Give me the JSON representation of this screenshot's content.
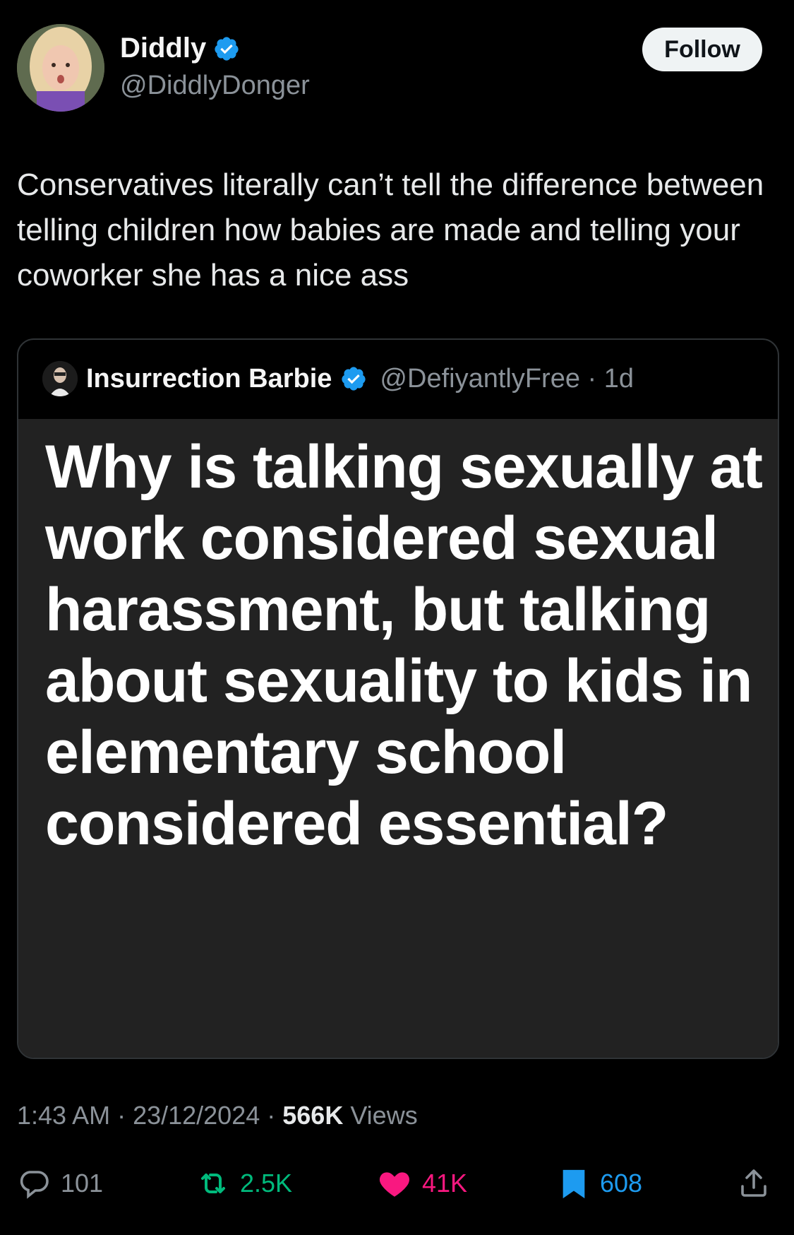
{
  "author": {
    "display_name": "Diddly",
    "handle": "@DiddlyDonger",
    "follow_label": "Follow"
  },
  "tweet": {
    "text": "Conservatives literally can’t tell the difference between telling children how babies are made and telling your coworker she has a nice ass"
  },
  "quote": {
    "display_name": "Insurrection Barbie",
    "handle_time": "@DefiyantlyFree · 1d",
    "image_text": "Why is talking sexually at work considered sexual harassment, but talking about sexuality to kids in elementary school considered essential?"
  },
  "meta": {
    "time_date": "1:43 AM · 23/12/2024 · ",
    "views_count": "566K",
    "views_label": " Views"
  },
  "actions": {
    "replies": "101",
    "reposts": "2.5K",
    "likes": "41K",
    "bookmarks": "608"
  },
  "colors": {
    "verified": "#1d9bf0",
    "repost": "#00ba7c",
    "like": "#f91880",
    "bookmark": "#1d9bf0",
    "muted": "#8b9299"
  },
  "icons": [
    "verified-badge-icon",
    "reply-icon",
    "repost-icon",
    "heart-icon",
    "bookmark-icon",
    "share-icon"
  ]
}
